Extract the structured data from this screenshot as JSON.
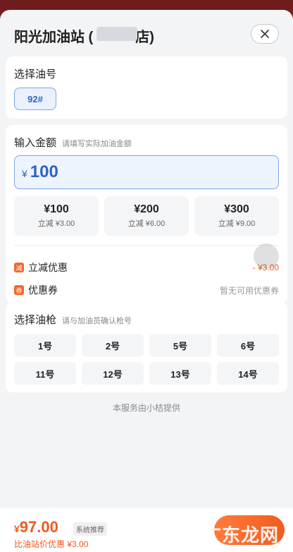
{
  "header": {
    "title": "阳光加油站 (",
    "title_end": "店)"
  },
  "fuel": {
    "title": "选择油号",
    "selected": "92#"
  },
  "amount": {
    "title": "输入金额",
    "subtitle": "请填写实际加油金额",
    "currency": "¥",
    "value": "100",
    "presets": [
      {
        "amount": "¥100",
        "discount": "立减 ¥3.00"
      },
      {
        "amount": "¥200",
        "discount": "立减 ¥6.00"
      },
      {
        "amount": "¥300",
        "discount": "立减 ¥9.00"
      }
    ],
    "instant_discount": {
      "badge": "减",
      "label": "立减优惠",
      "value": "- ¥3.00"
    },
    "coupon": {
      "badge": "券",
      "label": "优惠券",
      "value": "暂无可用优惠券"
    }
  },
  "nozzle": {
    "title": "选择油枪",
    "subtitle": "请与加油员确认枪号",
    "items": [
      "1号",
      "2号",
      "5号",
      "6号",
      "11号",
      "12号",
      "13号",
      "14号"
    ]
  },
  "provider_text": "本服务由小桔提供",
  "footer": {
    "currency": "¥",
    "price": "97.00",
    "tag": "系统推荐",
    "compare": "比油站价优惠 ¥3.00",
    "watermark": "广东龙网"
  },
  "colors": {
    "accent_blue": "#2f63c9",
    "accent_orange": "#ef5a1d"
  }
}
